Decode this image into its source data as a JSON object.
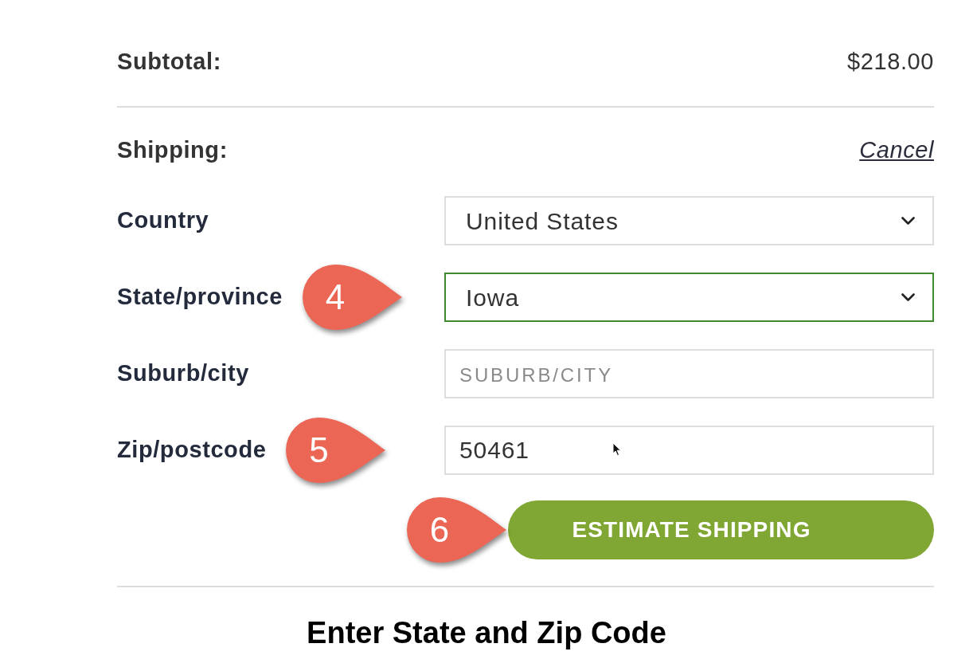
{
  "order_summary": {
    "subtotal_label": "Subtotal:",
    "subtotal_value": "$218.00"
  },
  "shipping": {
    "label": "Shipping:",
    "cancel_link": "Cancel",
    "fields": [
      {
        "kind": "select",
        "label": "Country",
        "value": "United States",
        "focused": false,
        "hovered": false
      },
      {
        "kind": "select",
        "label": "State/province",
        "value": "Iowa",
        "focused": true,
        "hovered": false,
        "callout": "4"
      },
      {
        "kind": "text",
        "label": "Suburb/city",
        "placeholder": "SUBURB/CITY",
        "focused": false,
        "hovered": false
      },
      {
        "kind": "text",
        "label": "Zip/postcode",
        "value": "50461",
        "focused": false,
        "hovered": true,
        "callout": "5"
      }
    ],
    "submit_button": {
      "label": "ESTIMATE SHIPPING",
      "callout": "6"
    }
  },
  "caption": "Enter State and Zip Code"
}
